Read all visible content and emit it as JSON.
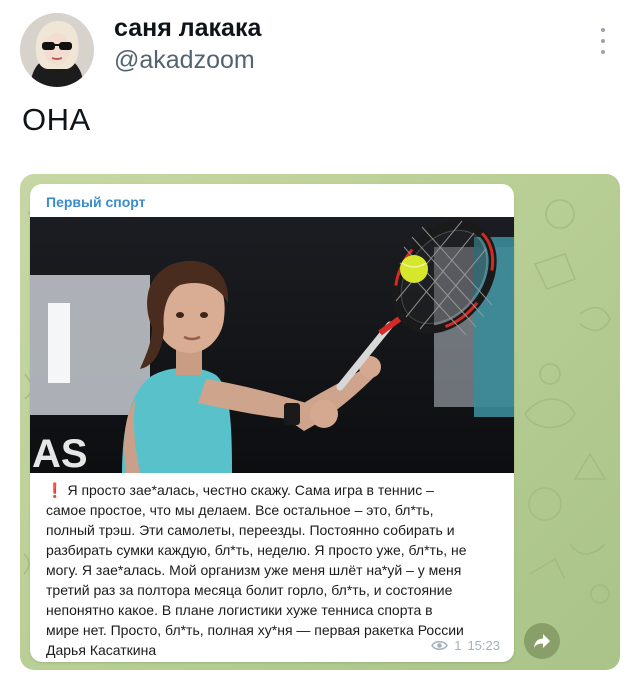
{
  "tweet": {
    "author_name": "саня лакака",
    "author_handle": "@akadzoom",
    "text": "ОНА",
    "more_icon": "three-dots-vertical-icon"
  },
  "telegram_post": {
    "channel_name": "Первый спорт",
    "message_lines": [
      "Я просто зае*алась, честно скажу. Сама игра в теннис –",
      "самое простое, что мы делаем. Все остальное – это, бл*ть,",
      "полный трэш. Эти самолеты, переезды. Постоянно собирать и",
      "разбирать сумки каждую, бл*ть, неделю. Я просто уже, бл*ть, не",
      "могу. Я зае*алась. Мой организм уже меня шлёт на*уй – у меня",
      "третий раз за полтора месяца болит горло, бл*ть, и состояние",
      "непонятно какое. В плане логистики хуже тенниса спорта в",
      "мире нет. Просто, бл*ть, полная ху*ня — первая ракетка России",
      "Дарья Касаткина"
    ],
    "exclamation": "❗",
    "views": "1",
    "time": "15:23",
    "photo_banner_text": "AS",
    "photo_alt": "tennis player hitting a forehand",
    "icons": {
      "views": "eye-icon",
      "share": "share-arrow-icon"
    }
  },
  "colors": {
    "channel_link": "#3a8ccb",
    "wallpaper": "#b9cf95",
    "meta_text": "#a3b0bd",
    "handle": "#536471"
  }
}
